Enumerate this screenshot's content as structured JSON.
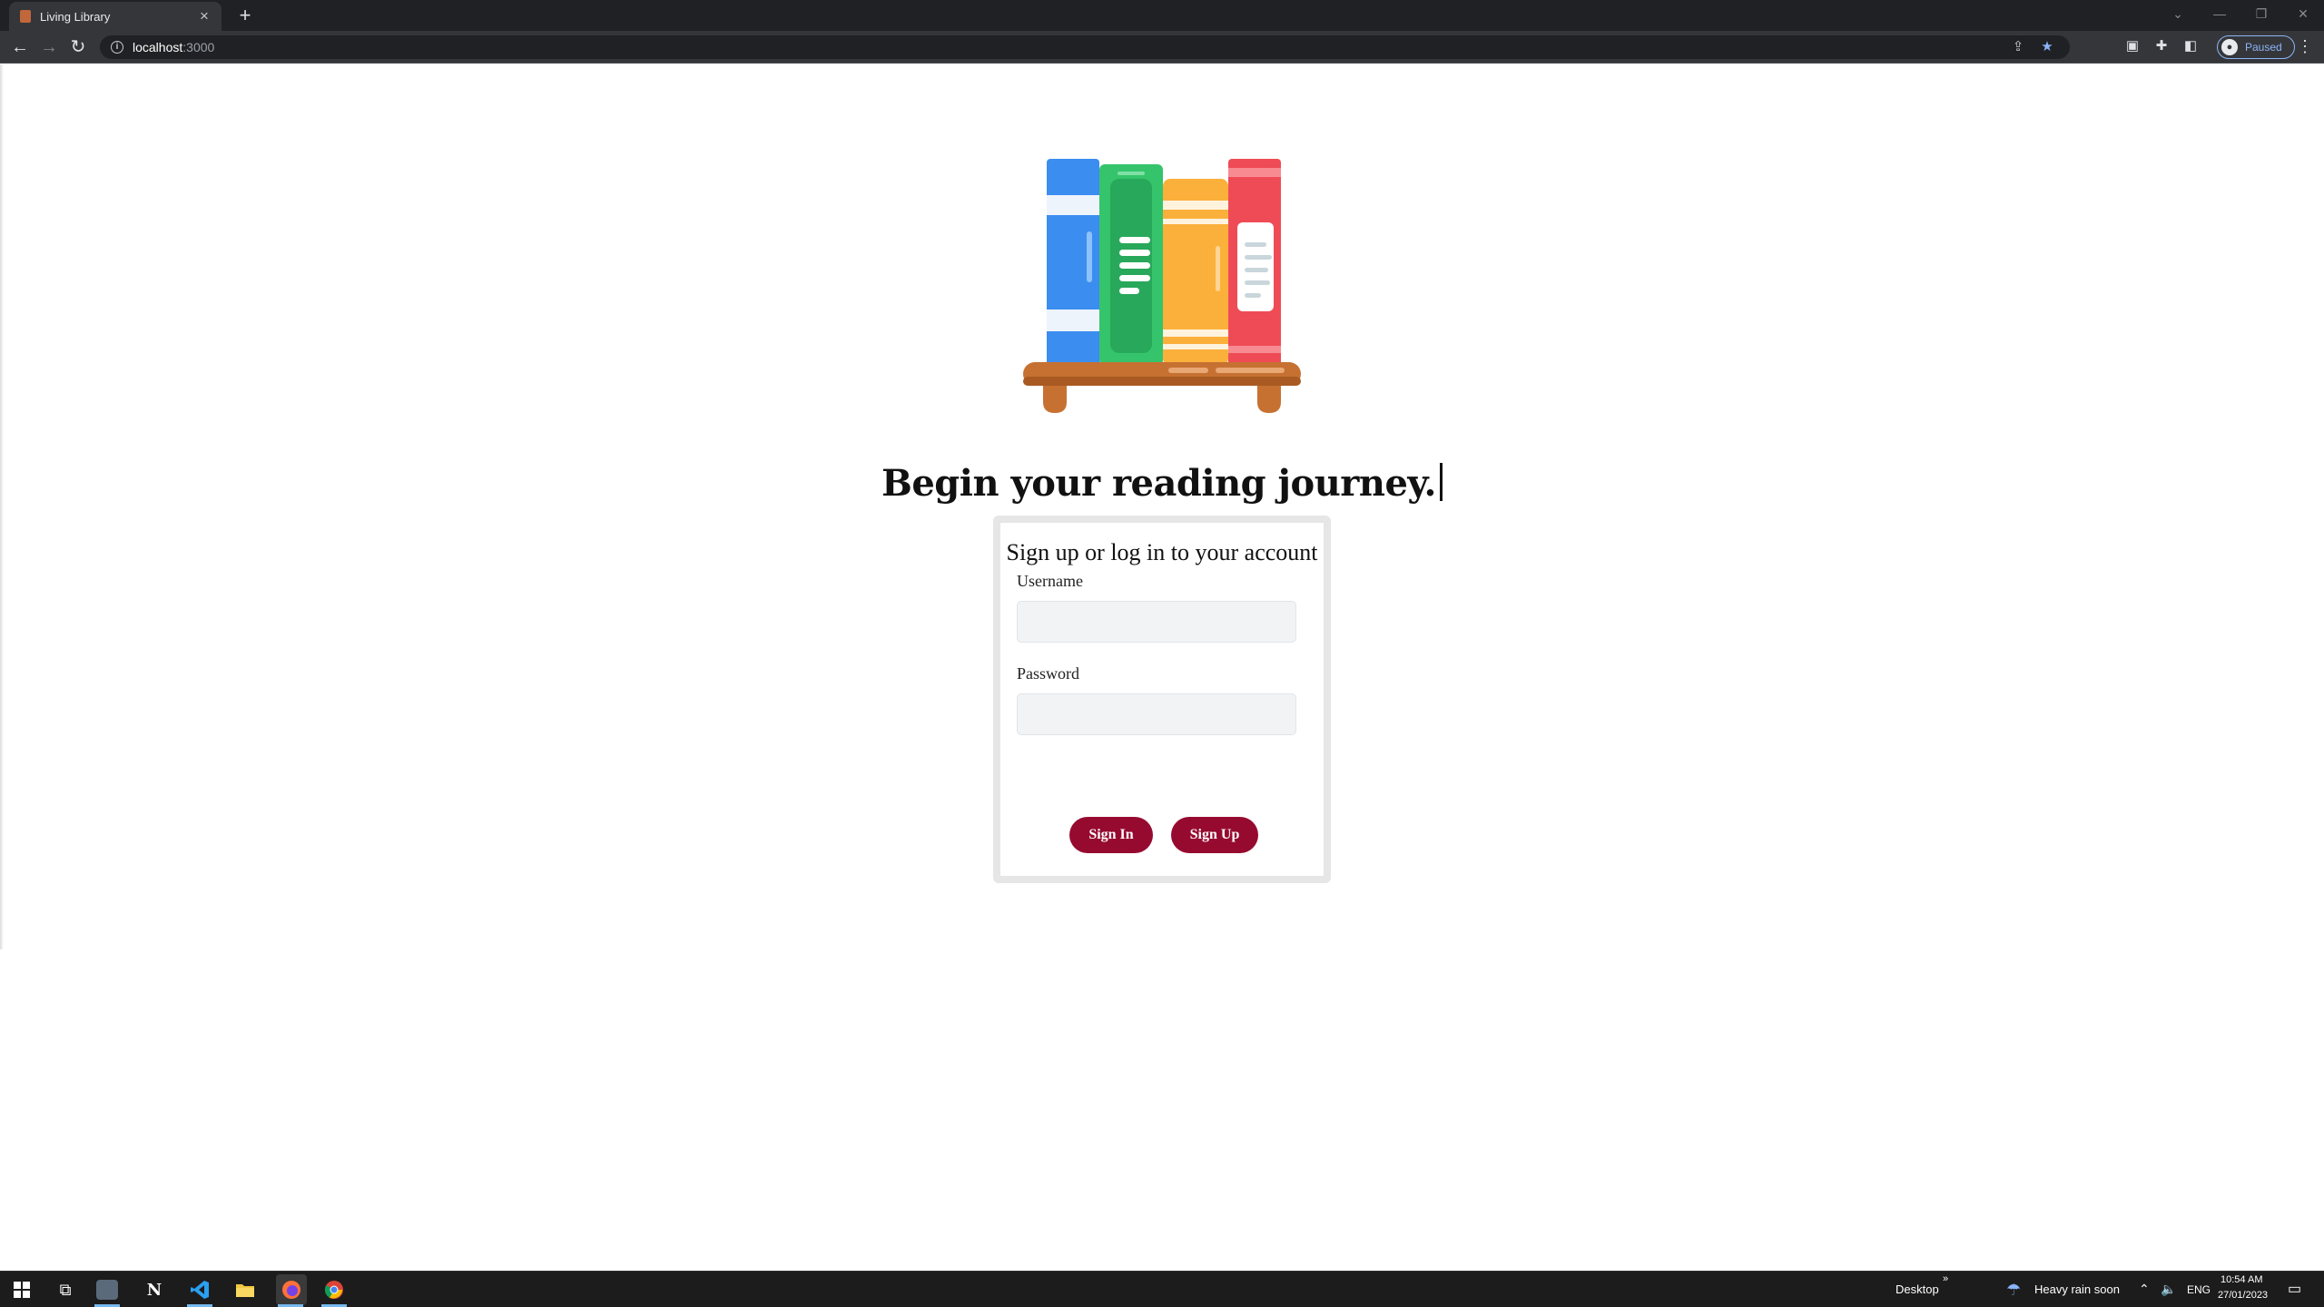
{
  "browser": {
    "tab_title": "Living Library",
    "tab_close": "×",
    "new_tab": "+",
    "url_host": "localhost",
    "url_port": ":3000",
    "profile_status": "Paused",
    "window_controls": [
      "⌄",
      "—",
      "❐",
      "✕"
    ]
  },
  "page": {
    "headline": "Begin your reading journey.",
    "card_title": "Sign up or log in to your account",
    "username_label": "Username",
    "username_value": "",
    "password_label": "Password",
    "password_value": "",
    "sign_in_label": "Sign In",
    "sign_up_label": "Sign Up"
  },
  "logo": {
    "description_icon": "bookshelf-icon",
    "colors": {
      "blue": "#3b8df0",
      "green": "#35c46b",
      "yellow": "#fbb03b",
      "red": "#ef4b56",
      "shelf": "#c67132"
    }
  },
  "taskbar": {
    "desktop_label": "Desktop",
    "weather_label": "Heavy rain soon",
    "language": "ENG",
    "time": "10:54 AM",
    "date": "27/01/2023",
    "apps": [
      "start-icon",
      "task-view-icon",
      "mail-icon",
      "notion-icon",
      "vscode-icon",
      "file-explorer-icon",
      "firefox-icon",
      "chrome-icon"
    ]
  },
  "colors": {
    "button_bg": "#960a30",
    "button_text": "#ffffff",
    "input_bg": "#f1f3f5",
    "card_border": "#e6e6e6",
    "browser_dark": "#202124",
    "taskbar_bg": "#1c1c1c"
  }
}
